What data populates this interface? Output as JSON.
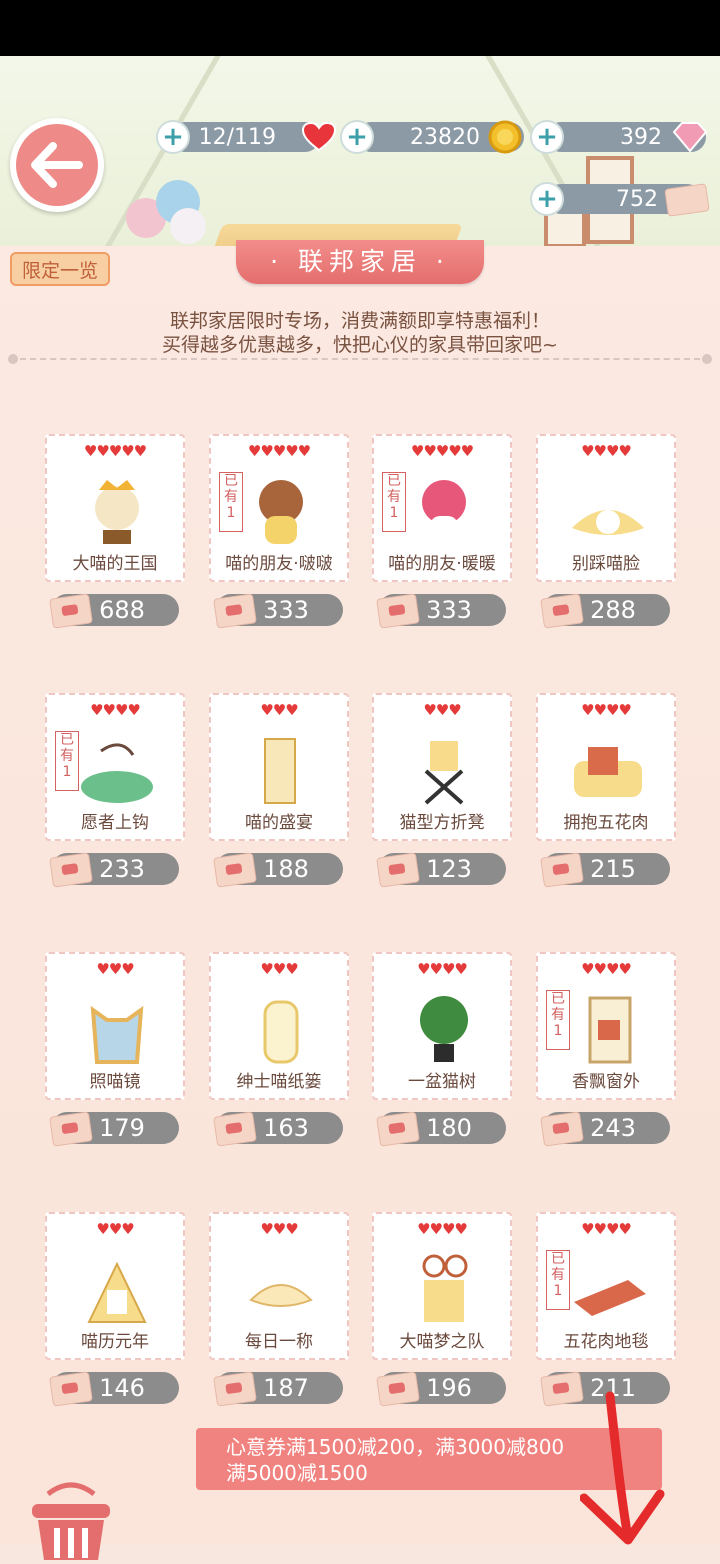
{
  "resources": {
    "hearts": "12/119",
    "coins": "23820",
    "gems": "392",
    "tickets": "752"
  },
  "tabs": {
    "limited": "限定一览"
  },
  "title": "· 联邦家居 ·",
  "description": [
    "联邦家居限时专场，消费满额即享特惠福利！",
    "买得越多优惠越多，快把心仪的家具带回家吧~"
  ],
  "owned_badge": "已有 1",
  "items": [
    {
      "name": "大喵的王国",
      "hearts": "♥♥♥♥♥",
      "price": "688",
      "owned": false
    },
    {
      "name": "喵的朋友·啵啵",
      "hearts": "♥♥♥♥♥",
      "price": "333",
      "owned": true
    },
    {
      "name": "喵的朋友·暖暖",
      "hearts": "♥♥♥♥♥",
      "price": "333",
      "owned": true
    },
    {
      "name": "别踩喵脸",
      "hearts": "♥♥♥♥",
      "price": "288",
      "owned": false
    },
    {
      "name": "愿者上钩",
      "hearts": "♥♥♥♥",
      "price": "233",
      "owned": true
    },
    {
      "name": "喵的盛宴",
      "hearts": "♥♥♥",
      "price": "188",
      "owned": false
    },
    {
      "name": "猫型方折凳",
      "hearts": "♥♥♥",
      "price": "123",
      "owned": false
    },
    {
      "name": "拥抱五花肉",
      "hearts": "♥♥♥♥",
      "price": "215",
      "owned": false
    },
    {
      "name": "照喵镜",
      "hearts": "♥♥♥",
      "price": "179",
      "owned": false
    },
    {
      "name": "绅士喵纸篓",
      "hearts": "♥♥♥",
      "price": "163",
      "owned": false
    },
    {
      "name": "一盆猫树",
      "hearts": "♥♥♥♥",
      "price": "180",
      "owned": false
    },
    {
      "name": "香飘窗外",
      "hearts": "♥♥♥♥",
      "price": "243",
      "owned": true
    },
    {
      "name": "喵历元年",
      "hearts": "♥♥♥",
      "price": "146",
      "owned": false
    },
    {
      "name": "每日一称",
      "hearts": "♥♥♥",
      "price": "187",
      "owned": false
    },
    {
      "name": "大喵梦之队",
      "hearts": "♥♥♥♥",
      "price": "196",
      "owned": false
    },
    {
      "name": "五花肉地毯",
      "hearts": "♥♥♥♥",
      "price": "211",
      "owned": true
    }
  ],
  "promo": {
    "line1": "心意券满1500减200，满3000减800",
    "line2": "满5000减1500"
  },
  "colors": {
    "accent": "#e46e6d",
    "heart": "#e43a3a",
    "pill": "#8c8c8c"
  }
}
